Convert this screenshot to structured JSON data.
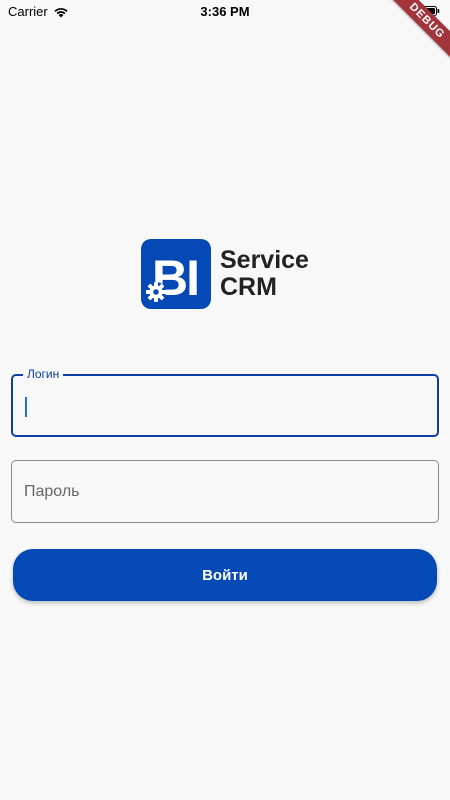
{
  "status_bar": {
    "carrier": "Carrier",
    "time": "3:36 PM",
    "icons": [
      "wifi-icon",
      "battery-icon"
    ]
  },
  "debug_banner": "DEBUG",
  "logo": {
    "mark_text": "BI",
    "line1": "Service",
    "line2": "CRM",
    "mark_color": "#0549b6"
  },
  "form": {
    "login_label": "Логин",
    "login_value": "",
    "password_placeholder": "Пароль",
    "password_value": "",
    "submit_label": "Войти"
  },
  "colors": {
    "accent": "#0549b6",
    "focused_border": "#0d3fa6",
    "background": "#f8f8f8"
  }
}
